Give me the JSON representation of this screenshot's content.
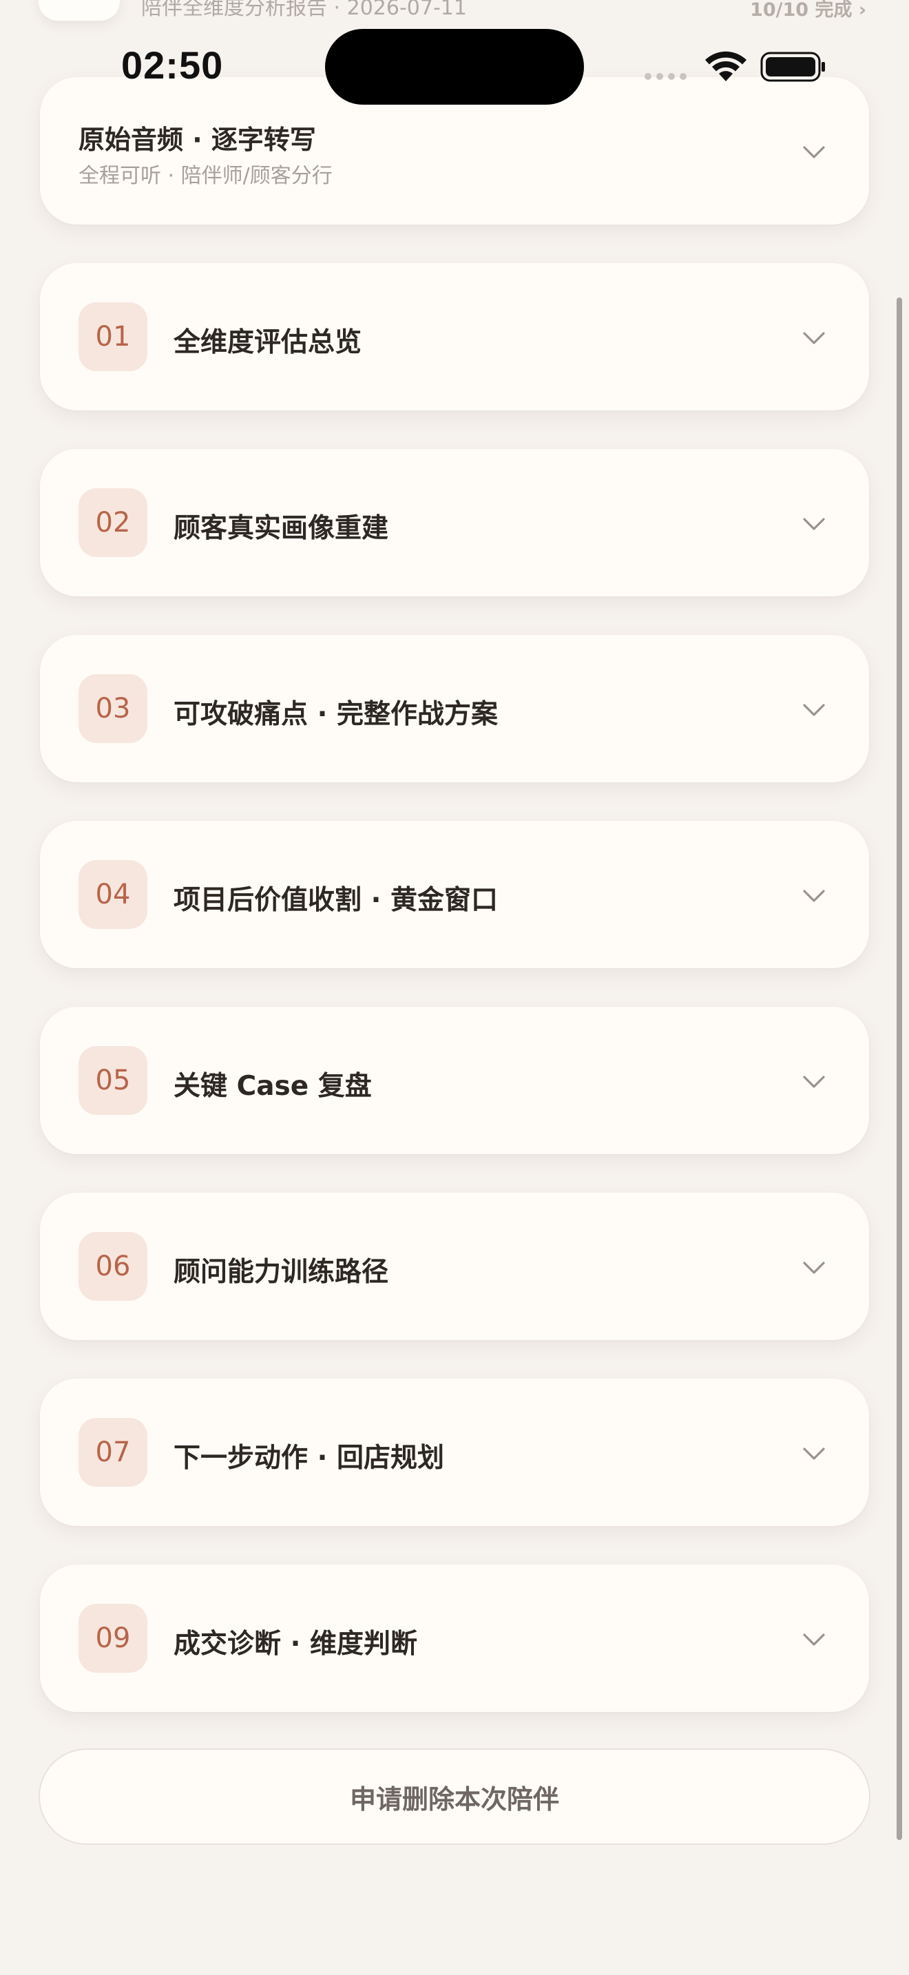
{
  "header": {
    "subtitle": "陪伴全维度分析报告 · 2026-07-11",
    "progress": "10/10 完成 ›"
  },
  "status_bar": {
    "time": "02:50"
  },
  "audio_card": {
    "title": "原始音频 · 逐字转写",
    "subtitle": "全程可听 · 陪伴师/顾客分行"
  },
  "sections": [
    {
      "num": "01",
      "title": "全维度评估总览"
    },
    {
      "num": "02",
      "title": "顾客真实画像重建"
    },
    {
      "num": "03",
      "title": "可攻破痛点 · 完整作战方案"
    },
    {
      "num": "04",
      "title": "项目后价值收割 · 黄金窗口"
    },
    {
      "num": "05",
      "title": "关键 Case 复盘"
    },
    {
      "num": "06",
      "title": "顾问能力训练路径"
    },
    {
      "num": "07",
      "title": "下一步动作 · 回店规划"
    },
    {
      "num": "09",
      "title": "成交诊断 · 维度判断"
    }
  ],
  "actions": {
    "delete_label": "申请删除本次陪伴"
  },
  "colors": {
    "background": "#f6f2ee",
    "card": "#fffcf7",
    "badge_bg": "#f6e6de",
    "badge_text": "#b7644a",
    "title_text": "#2e2823"
  }
}
